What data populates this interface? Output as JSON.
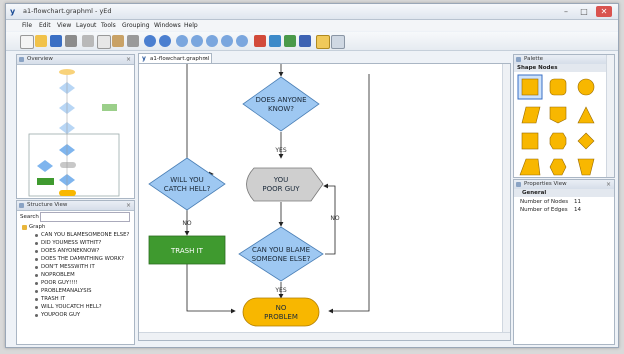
{
  "window": {
    "title": "a1-flowchart.graphml - yEd",
    "app_glyph": "y",
    "minimize": "–",
    "maximize": "□",
    "close": "✕"
  },
  "menu": [
    "File",
    "Edit",
    "View",
    "Layout",
    "Tools",
    "Grouping",
    "Windows",
    "Help"
  ],
  "toolbar": {
    "icons": [
      "new-icon",
      "open-icon",
      "save-icon",
      "print-icon",
      "cut-icon",
      "copy-icon",
      "paste-icon",
      "delete-icon",
      "undo-icon",
      "redo-icon",
      "zoom-in-icon",
      "zoom-out-icon",
      "zoom-fit-icon",
      "zoom-area-icon",
      "zoom-original-icon",
      "export-image-icon",
      "properties-icon",
      "layout-icon",
      "grid-icon",
      "snap-icon",
      "settings-icon"
    ]
  },
  "overview": {
    "title": "Overview"
  },
  "structure": {
    "title": "Structure View",
    "search_label": "Search",
    "root": "Graph",
    "items": [
      "CAN YOU BLAMESOMEONE ELSE?",
      "DID YOUMESS WITHIT?",
      "DOES ANYONEKNOW?",
      "DOES THE DAMNTHING WORK?",
      "DON'T MESSWITH IT",
      "NOPROBLEM",
      "POOR GUY!!!!",
      "PROBLEMANALYSIS",
      "TRASH IT",
      "WILL YOUCATCH HELL?",
      "YOUPOOR GUY"
    ]
  },
  "document_tab": {
    "label": "a1-flowchart.graphml *",
    "close": "×"
  },
  "flowchart": {
    "nodes": {
      "does_anyone_know": [
        "DOES ANYONE",
        "KNOW?"
      ],
      "you_poor_guy": [
        "YOU",
        "POOR GUY"
      ],
      "will_you_catch_hell": [
        "WILL YOU",
        "CATCH HELL?"
      ],
      "trash_it": [
        "TRASH IT"
      ],
      "can_you_blame": [
        "CAN YOU BLAME",
        "SOMEONE ELSE?"
      ],
      "no_problem": [
        "NO",
        "PROBLEM"
      ]
    },
    "edge_labels": {
      "yes_top": "YES",
      "no_left": "NO",
      "no_right": "NO",
      "yes_bottom": "YES"
    },
    "colors": {
      "decision": "#9ec8f2",
      "process_gray": "#cfcfcf",
      "trash_green": "#3f9a2f",
      "terminal": "#f8b700"
    }
  },
  "palette": {
    "title": "Palette",
    "section": "Shape Nodes",
    "selected_index": 0,
    "fill": "#f8b700"
  },
  "properties": {
    "title": "Properties View",
    "section": "General",
    "rows": [
      {
        "label": "Number of Nodes",
        "value": "11"
      },
      {
        "label": "Number of Edges",
        "value": "14"
      }
    ]
  }
}
